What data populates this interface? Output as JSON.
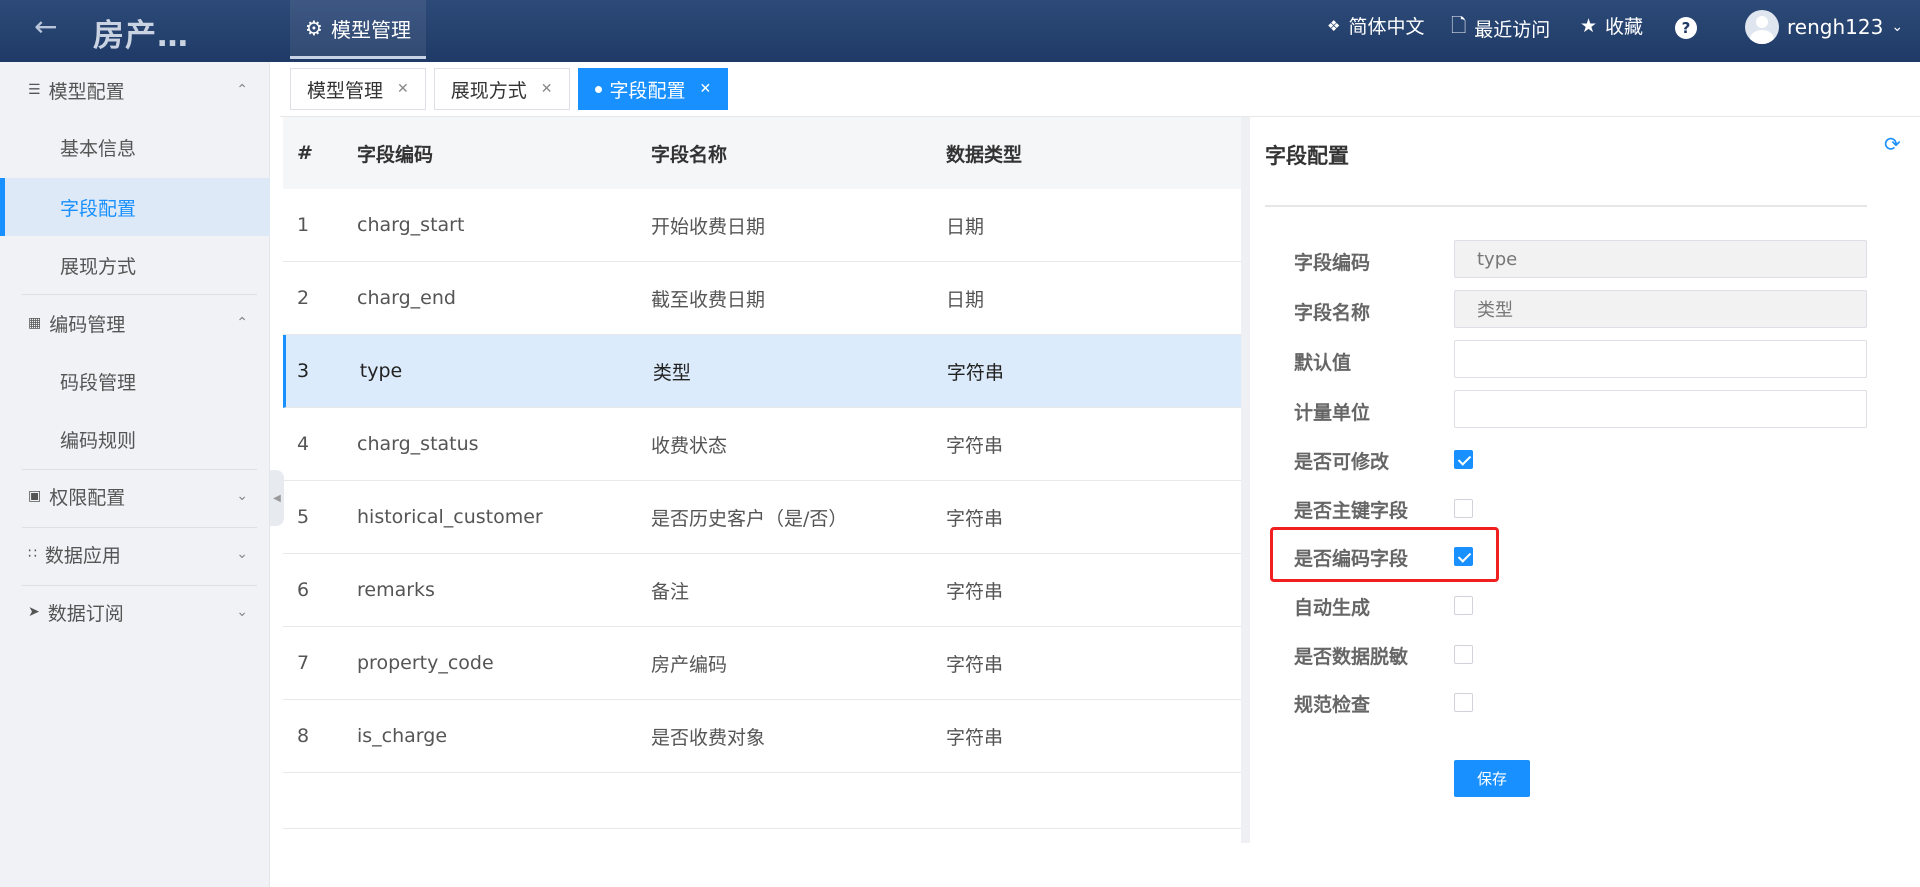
{
  "header": {
    "back_icon": "arrow-left-icon",
    "brand": "房产…",
    "nav_tab": "模型管理",
    "lang": "简体中文",
    "recent": "最近访问",
    "favorite": "收藏",
    "help": "?",
    "username": "rengh123"
  },
  "sidebar": {
    "groups": [
      {
        "label": "模型配置",
        "icon": "layers-icon",
        "expanded": true
      },
      {
        "label": "编码管理",
        "icon": "code-icon",
        "expanded": true
      },
      {
        "label": "权限配置",
        "icon": "permission-icon",
        "expanded": false
      },
      {
        "label": "数据应用",
        "icon": "apps-icon",
        "expanded": false
      },
      {
        "label": "数据订阅",
        "icon": "send-icon",
        "expanded": false
      }
    ],
    "items": [
      {
        "label": "基本信息"
      },
      {
        "label": "字段配置",
        "active": true
      },
      {
        "label": "展现方式"
      },
      {
        "label": "码段管理"
      },
      {
        "label": "编码规则"
      }
    ]
  },
  "tabs": [
    {
      "label": "模型管理"
    },
    {
      "label": "展现方式"
    },
    {
      "label": "字段配置",
      "active": true
    }
  ],
  "table": {
    "headers": [
      "#",
      "字段编码",
      "字段名称",
      "数据类型"
    ],
    "rows": [
      [
        "1",
        "charg_start",
        "开始收费日期",
        "日期"
      ],
      [
        "2",
        "charg_end",
        "截至收费日期",
        "日期"
      ],
      [
        "3",
        "type",
        "类型",
        "字符串"
      ],
      [
        "4",
        "charg_status",
        "收费状态",
        "字符串"
      ],
      [
        "5",
        "historical_customer",
        "是否历史客户（是/否）",
        "字符串"
      ],
      [
        "6",
        "remarks",
        "备注",
        "字符串"
      ],
      [
        "7",
        "property_code",
        "房产编码",
        "字符串"
      ],
      [
        "8",
        "is_charge",
        "是否收费对象",
        "字符串"
      ]
    ],
    "selected_row": 3
  },
  "panel": {
    "title": "字段配置",
    "fields": {
      "code_label": "字段编码",
      "code_value": "type",
      "name_label": "字段名称",
      "name_value": "类型",
      "default_label": "默认值",
      "default_value": "",
      "unit_label": "计量单位",
      "unit_value": ""
    },
    "checks": [
      {
        "label": "是否可修改",
        "checked": true
      },
      {
        "label": "是否主键字段",
        "checked": false
      },
      {
        "label": "是否编码字段",
        "checked": true
      },
      {
        "label": "自动生成",
        "checked": false
      },
      {
        "label": "是否数据脱敏",
        "checked": false
      },
      {
        "label": "规范检查",
        "checked": false
      }
    ],
    "save": "保存"
  },
  "colors": {
    "accent": "#1890ff",
    "header": "#1f3a66",
    "highlight": "#f02020"
  }
}
